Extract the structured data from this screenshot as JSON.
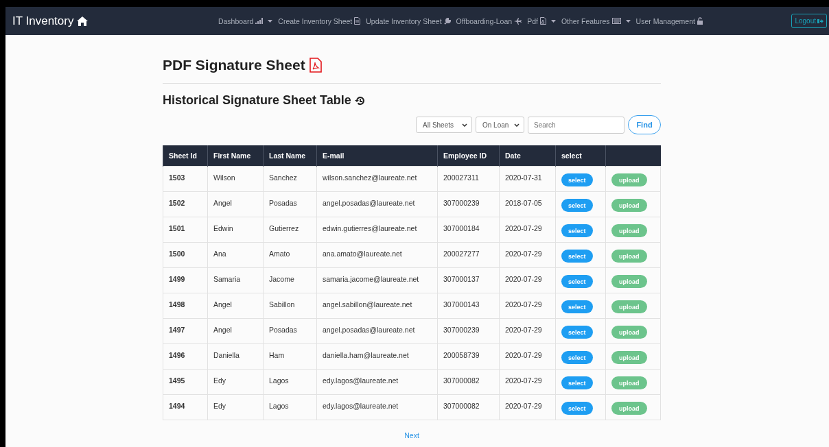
{
  "navbar": {
    "brand": "IT Inventory",
    "items": [
      {
        "label": "Dashboard",
        "dropdown": true
      },
      {
        "label": "Create Inventory Sheet",
        "dropdown": false
      },
      {
        "label": "Update Inventory Sheet",
        "dropdown": false
      },
      {
        "label": "Offboarding-Loan",
        "dropdown": false
      },
      {
        "label": "Pdf",
        "dropdown": true
      },
      {
        "label": "Other Features",
        "dropdown": true
      },
      {
        "label": "User Management",
        "dropdown": false
      }
    ],
    "logout": "Logout"
  },
  "page_title": "PDF Signature Sheet",
  "section_title": "Historical Signature Sheet Table",
  "filters": [
    {
      "value": "All Sheets"
    },
    {
      "value": "On Loan"
    }
  ],
  "search": {
    "placeholder": "Search"
  },
  "find_button": "Find",
  "table": {
    "columns": [
      "Sheet Id",
      "First Name",
      "Last Name",
      "E-mail",
      "Employee ID",
      "Date",
      "select"
    ],
    "rows": [
      {
        "id": "1503",
        "first": "Wilson",
        "last": "Sanchez",
        "email": "wilson.sanchez@laureate.net",
        "employee_id": "200027311",
        "date": "2020-07-31",
        "select": "select",
        "upload": "upload"
      },
      {
        "id": "1502",
        "first": "Angel",
        "last": "Posadas",
        "email": "angel.posadas@laureate.net",
        "employee_id": "307000239",
        "date": "2018-07-05",
        "select": "select",
        "upload": "upload"
      },
      {
        "id": "1501",
        "first": "Edwin",
        "last": "Gutierrez",
        "email": "edwin.gutierres@laureate.net",
        "employee_id": "307000184",
        "date": "2020-07-29",
        "select": "select",
        "upload": "upload"
      },
      {
        "id": "1500",
        "first": "Ana",
        "last": "Amato",
        "email": "ana.amato@laureate.net",
        "employee_id": "200027277",
        "date": "2020-07-29",
        "select": "select",
        "upload": "upload"
      },
      {
        "id": "1499",
        "first": "Samaria",
        "last": "Jacome",
        "email": "samaria.jacome@laureate.net",
        "employee_id": "307000137",
        "date": "2020-07-29",
        "select": "select",
        "upload": "upload"
      },
      {
        "id": "1498",
        "first": "Angel",
        "last": "Sabillon",
        "email": "angel.sabillon@laureate.net",
        "employee_id": "307000143",
        "date": "2020-07-29",
        "select": "select",
        "upload": "upload"
      },
      {
        "id": "1497",
        "first": "Angel",
        "last": "Posadas",
        "email": "angel.posadas@laureate.net",
        "employee_id": "307000239",
        "date": "2020-07-29",
        "select": "select",
        "upload": "upload"
      },
      {
        "id": "1496",
        "first": "Daniella",
        "last": "Ham",
        "email": "daniella.ham@laureate.net",
        "employee_id": "200058739",
        "date": "2020-07-29",
        "select": "select",
        "upload": "upload"
      },
      {
        "id": "1495",
        "first": "Edy",
        "last": "Lagos",
        "email": "edy.lagos@laureate.net",
        "employee_id": "307000082",
        "date": "2020-07-29",
        "select": "select",
        "upload": "upload"
      },
      {
        "id": "1494",
        "first": "Edy",
        "last": "Lagos",
        "email": "edy.lagos@laureate.net",
        "employee_id": "307000082",
        "date": "2020-07-29",
        "select": "select",
        "upload": "upload"
      }
    ]
  },
  "pagination": {
    "next": "Next"
  }
}
